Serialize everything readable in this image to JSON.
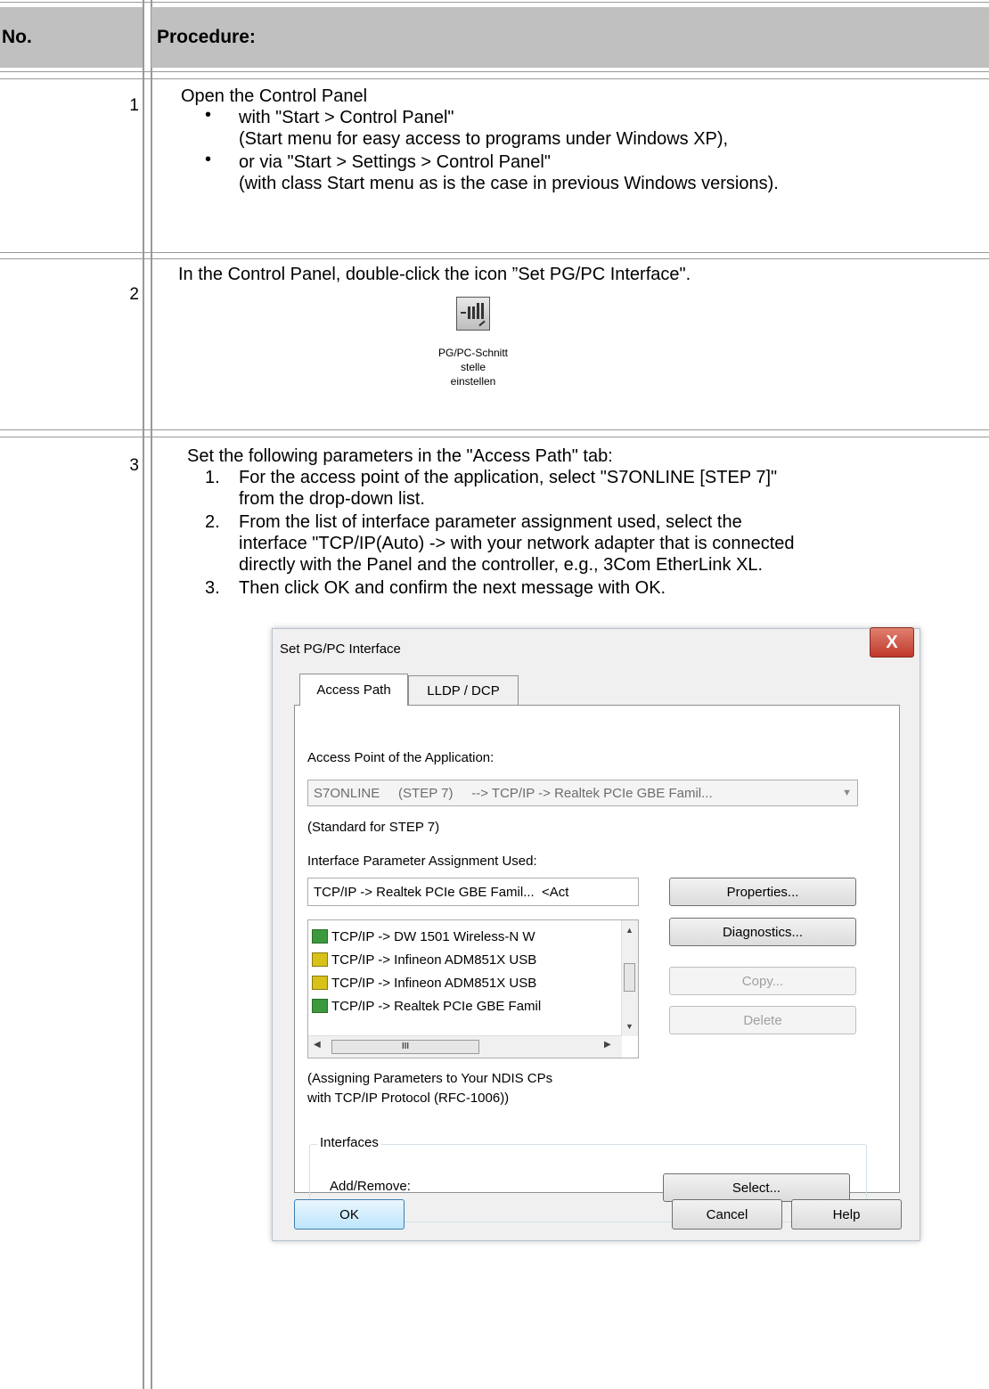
{
  "table": {
    "header_no": "No.",
    "header_procedure": "Procedure:"
  },
  "step1": {
    "number": "1",
    "intro": "Open the Control Panel",
    "bullet1_line1": "with \"Start > Control Panel\"",
    "bullet1_line2": "(Start menu for easy access to programs under Windows XP),",
    "bullet2_line1": "or via \"Start > Settings > Control Panel\"",
    "bullet2_line2": "(with class Start menu as is the case in previous Windows versions)."
  },
  "step2": {
    "number": "2",
    "text": "In the Control Panel, double-click the icon ”Set PG/PC Interface\".",
    "icon": "pg-pc-interface-icon",
    "icon_caption": [
      "PG/PC-Schnitt",
      "stelle",
      "einstellen"
    ]
  },
  "step3": {
    "number": "3",
    "intro": "Set the following parameters in the \"Access Path\" tab:",
    "items": [
      {
        "n": "1.",
        "lines": [
          "For the access point of the application, select \"S7ONLINE [STEP 7]\"",
          "from the drop-down list."
        ]
      },
      {
        "n": "2.",
        "lines": [
          "From the list of interface parameter assignment used, select the",
          "interface \"TCP/IP(Auto) -> with your network adapter that is connected",
          "directly with the Panel and the controller, e.g., 3Com EtherLink XL."
        ]
      },
      {
        "n": "3.",
        "lines": [
          "Then click OK and confirm the next message with OK."
        ]
      }
    ]
  },
  "dialog": {
    "title": "Set PG/PC Interface",
    "close_glyph": "X",
    "tabs": [
      "Access Path",
      "LLDP / DCP"
    ],
    "access_point_label": "Access Point of the Application:",
    "access_point_value": "S7ONLINE     (STEP 7)     --> TCP/IP -> Realtek PCIe GBE Famil...",
    "standard_note": "(Standard for STEP 7)",
    "ipa_label": "Interface Parameter Assignment Used:",
    "ipa_value": "TCP/IP -> Realtek PCIe GBE Famil...  <Act",
    "list_items": [
      {
        "text": "TCP/IP -> DW 1501 Wireless-N W",
        "icon": "network-adapter-icon"
      },
      {
        "text": "TCP/IP -> Infineon ADM851X USB",
        "icon": "network-adapter-warning-icon"
      },
      {
        "text": "TCP/IP -> Infineon ADM851X USB",
        "icon": "network-adapter-warning-icon"
      },
      {
        "text": "TCP/IP -> Realtek PCIe GBE Famil",
        "icon": "network-adapter-icon"
      }
    ],
    "scroll_thumb_glyph": "III",
    "buttons": {
      "properties": "Properties...",
      "diagnostics": "Diagnostics...",
      "copy": "Copy...",
      "delete": "Delete",
      "select": "Select...",
      "ok": "OK",
      "cancel": "Cancel",
      "help": "Help"
    },
    "assign_note_line1": "(Assigning Parameters to Your NDIS CPs",
    "assign_note_line2": "with TCP/IP Protocol (RFC-1006))",
    "interfaces_group": "Interfaces",
    "add_remove_label": "Add/Remove:"
  }
}
